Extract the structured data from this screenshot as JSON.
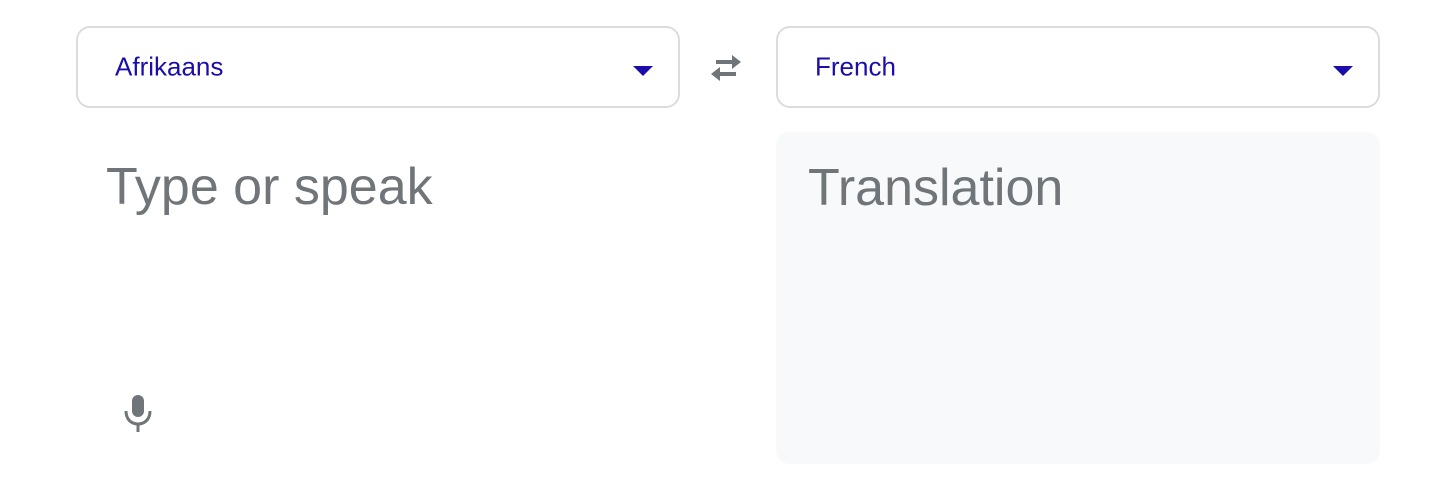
{
  "source_language": {
    "label": "Afrikaans",
    "dropdown_icon": "caret-down-icon"
  },
  "target_language": {
    "label": "French",
    "dropdown_icon": "caret-down-icon"
  },
  "swap": {
    "icon": "swap-arrows-icon"
  },
  "source_input": {
    "placeholder": "Type or speak",
    "value": ""
  },
  "mic": {
    "icon": "microphone-icon"
  },
  "translation": {
    "placeholder": "Translation"
  },
  "colors": {
    "accent": "#1a0dab",
    "placeholder_text": "#70757a",
    "icon_gray": "#70757a",
    "border": "#dadce0",
    "output_background": "#f8f9fa"
  }
}
